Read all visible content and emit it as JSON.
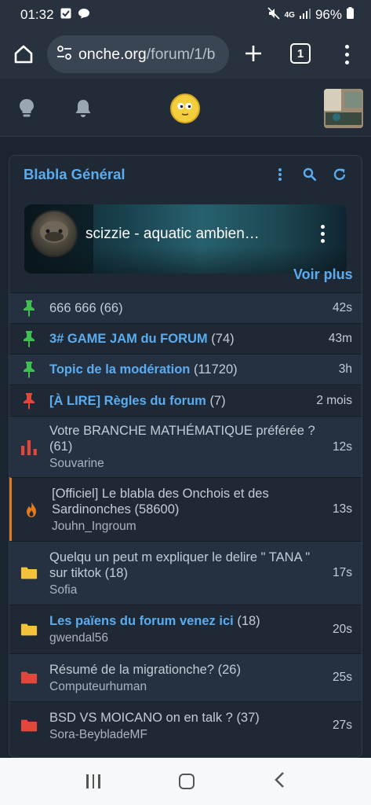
{
  "status_bar": {
    "time": "01:32",
    "network": "4G",
    "battery": "96%"
  },
  "browser": {
    "url_domain": "onche.org",
    "url_path": "/forum/1/b",
    "tab_count": "1"
  },
  "forum": {
    "title": "Blabla Général",
    "video": {
      "title": "scizzie - aquatic ambien…"
    },
    "voir_plus": "Voir plus",
    "topics": [
      {
        "title": "666 666",
        "count": "(66)",
        "author": "",
        "time": "42s",
        "icon": "pin-icon",
        "icon_color": "#3fbf4f",
        "link": false
      },
      {
        "title": "3# GAME JAM du FORUM",
        "count": "(74)",
        "author": "",
        "time": "43m",
        "icon": "pin-icon",
        "icon_color": "#3fbf4f",
        "link": true
      },
      {
        "title": "Topic de la modération",
        "count": "(11720)",
        "author": "",
        "time": "3h",
        "icon": "pin-icon",
        "icon_color": "#3fbf4f",
        "link": true
      },
      {
        "title": "[À LIRE] Règles du forum",
        "count": "(7)",
        "author": "",
        "time": "2 mois",
        "icon": "pin-icon",
        "icon_color": "#e2473b",
        "link": true
      },
      {
        "title": "Votre BRANCHE MATHÉMATIQUE préférée ?",
        "count": "(61)",
        "author": "Souvarine",
        "time": "12s",
        "icon": "poll-icon",
        "icon_color": "#e2473b",
        "link": false
      },
      {
        "title": "[Officiel] Le blabla des Onchois et des Sardinonches",
        "count": "(58600)",
        "author": "Jouhn_Ingroum",
        "time": "13s",
        "icon": "fire-icon",
        "icon_color": "#e27a1f",
        "link": false
      },
      {
        "title": "Quelqu un peut m expliquer le delire \" TANA \" sur tiktok",
        "count": "(18)",
        "author": "Sofia",
        "time": "17s",
        "icon": "folder-icon",
        "icon_color": "#f2c23a",
        "link": false
      },
      {
        "title": "Les païens du forum venez ici",
        "count": "(18)",
        "author": "gwendal56",
        "time": "20s",
        "icon": "folder-icon",
        "icon_color": "#f2c23a",
        "link": true
      },
      {
        "title": "Résumé de la migrationche?",
        "count": "(26)",
        "author": "Computeurhuman",
        "time": "25s",
        "icon": "folder-icon",
        "icon_color": "#e2473b",
        "link": false
      },
      {
        "title": "BSD VS MOICANO on en talk ?",
        "count": "(37)",
        "author": "Sora-BeybladeMF",
        "time": "27s",
        "icon": "folder-icon",
        "icon_color": "#e2473b",
        "link": false
      }
    ]
  }
}
